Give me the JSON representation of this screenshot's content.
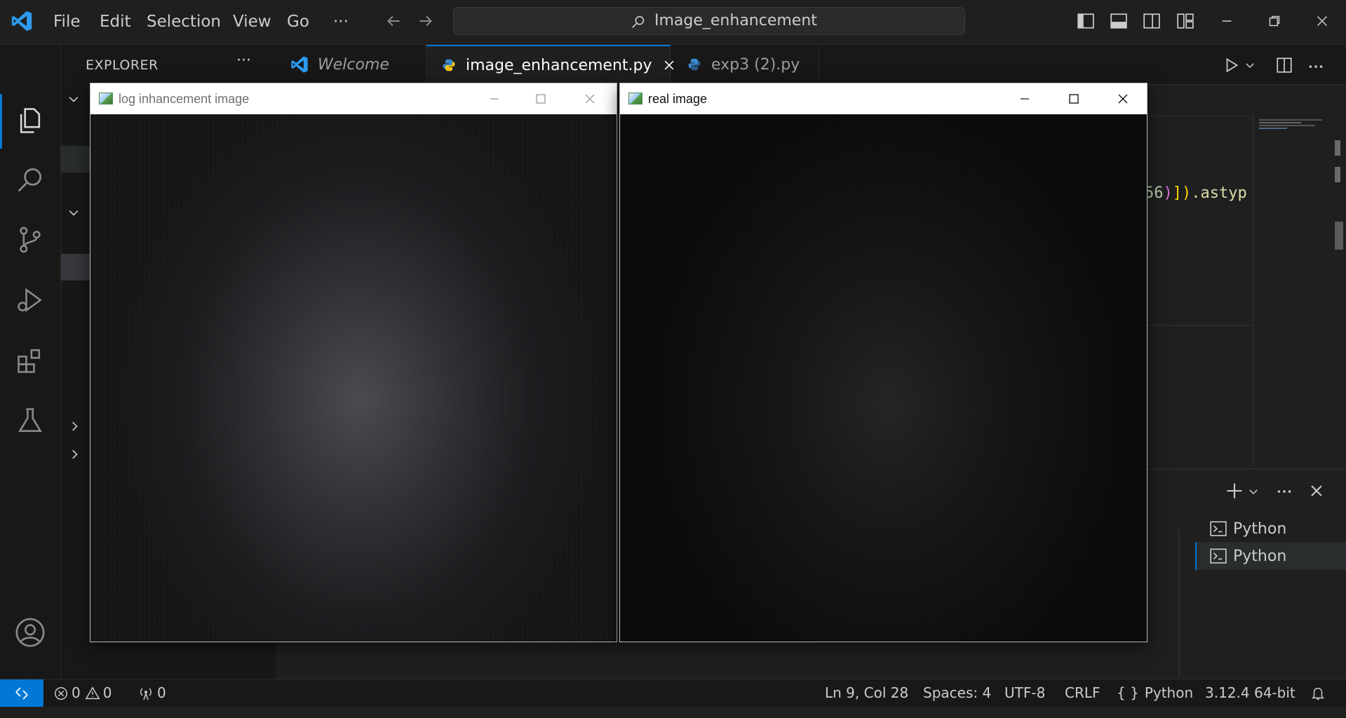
{
  "menu": {
    "file": "File",
    "edit": "Edit",
    "selection": "Selection",
    "view": "View",
    "go": "Go",
    "more": "···"
  },
  "search": {
    "text": "Image_enhancement"
  },
  "sidebar": {
    "title": "EXPLORER",
    "more": "···"
  },
  "tabs": [
    {
      "label": "Welcome"
    },
    {
      "label": "image_enhancement.py"
    },
    {
      "label": "exp3 (2).py"
    }
  ],
  "code_fragment": {
    "a": "56",
    "b": ")",
    "c": "])",
    "d": ".astyp"
  },
  "terminals": [
    {
      "label": "Python"
    },
    {
      "label": "Python"
    }
  ],
  "windows": {
    "log": {
      "title": "log inhancement image"
    },
    "real": {
      "title": "real image"
    }
  },
  "status": {
    "errors": "0",
    "warnings": "0",
    "ports": "0",
    "position": "Ln 9, Col 28",
    "spaces": "Spaces: 4",
    "encoding": "UTF-8",
    "eol": "CRLF",
    "language": "Python",
    "interpreter": "3.12.4 64-bit"
  },
  "colors": {
    "accent": "#0078d4",
    "background": "#1f1f1f",
    "bars": "#181818"
  }
}
